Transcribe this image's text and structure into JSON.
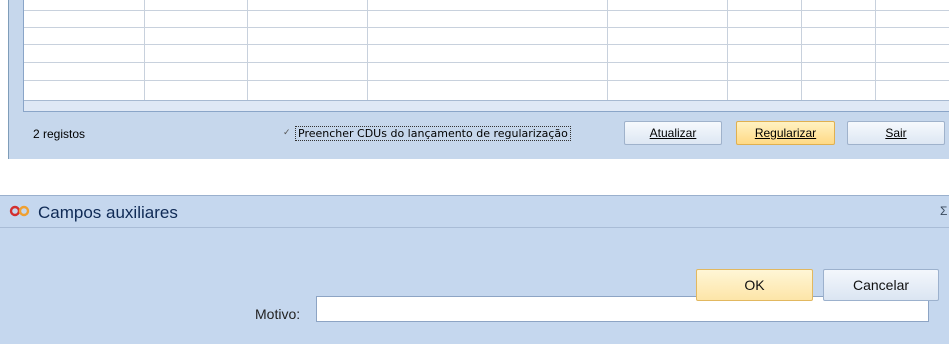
{
  "grid": {
    "status_text": "2 registos",
    "checkbox": {
      "checked": true,
      "label": "Preencher CDUs do lançamento de regularização"
    },
    "buttons": {
      "atualizar": "Atualizar",
      "regularizar": "Regularizar",
      "sair": "Sair"
    }
  },
  "dialog": {
    "title": "Campos auxiliares",
    "icon": "infinity-logo-icon",
    "motivo_label": "Motivo:",
    "motivo_value": "",
    "ok_label": "OK",
    "cancel_label": "Cancelar"
  },
  "colors": {
    "window_background": "#c5d7ee",
    "accent_button": "#ffd985",
    "logo_red": "#d32f2f",
    "logo_orange": "#f0a030"
  }
}
